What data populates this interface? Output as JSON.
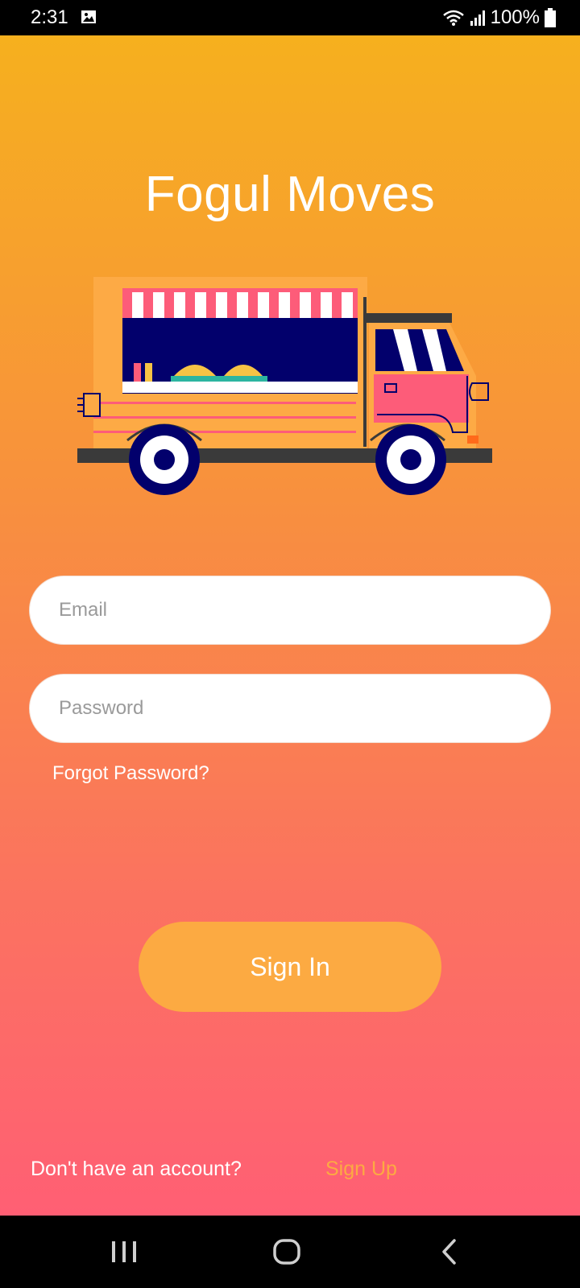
{
  "status_bar": {
    "time": "2:31",
    "battery": "100%",
    "icons": [
      "gallery-icon",
      "wifi-icon",
      "signal-icon",
      "battery-icon"
    ]
  },
  "app": {
    "title": "Fogul Moves",
    "illustration": "food-truck-illustration"
  },
  "form": {
    "email_placeholder": "Email",
    "email_value": "",
    "password_placeholder": "Password",
    "password_value": "",
    "forgot_label": "Forgot Password?",
    "signin_label": "Sign In"
  },
  "footer": {
    "prompt": "Don't have an account?",
    "signup_label": "Sign Up"
  },
  "nav_bar": {
    "icons": [
      "recents-icon",
      "home-icon",
      "back-icon"
    ]
  },
  "colors": {
    "gradient_top": "#F6B01E",
    "gradient_bottom": "#FF5F74",
    "button": "#FCAA42",
    "link_accent": "#FCAA42",
    "truck_body": "#FDAA45",
    "truck_pink": "#FD5C79",
    "truck_navy": "#02006C"
  }
}
